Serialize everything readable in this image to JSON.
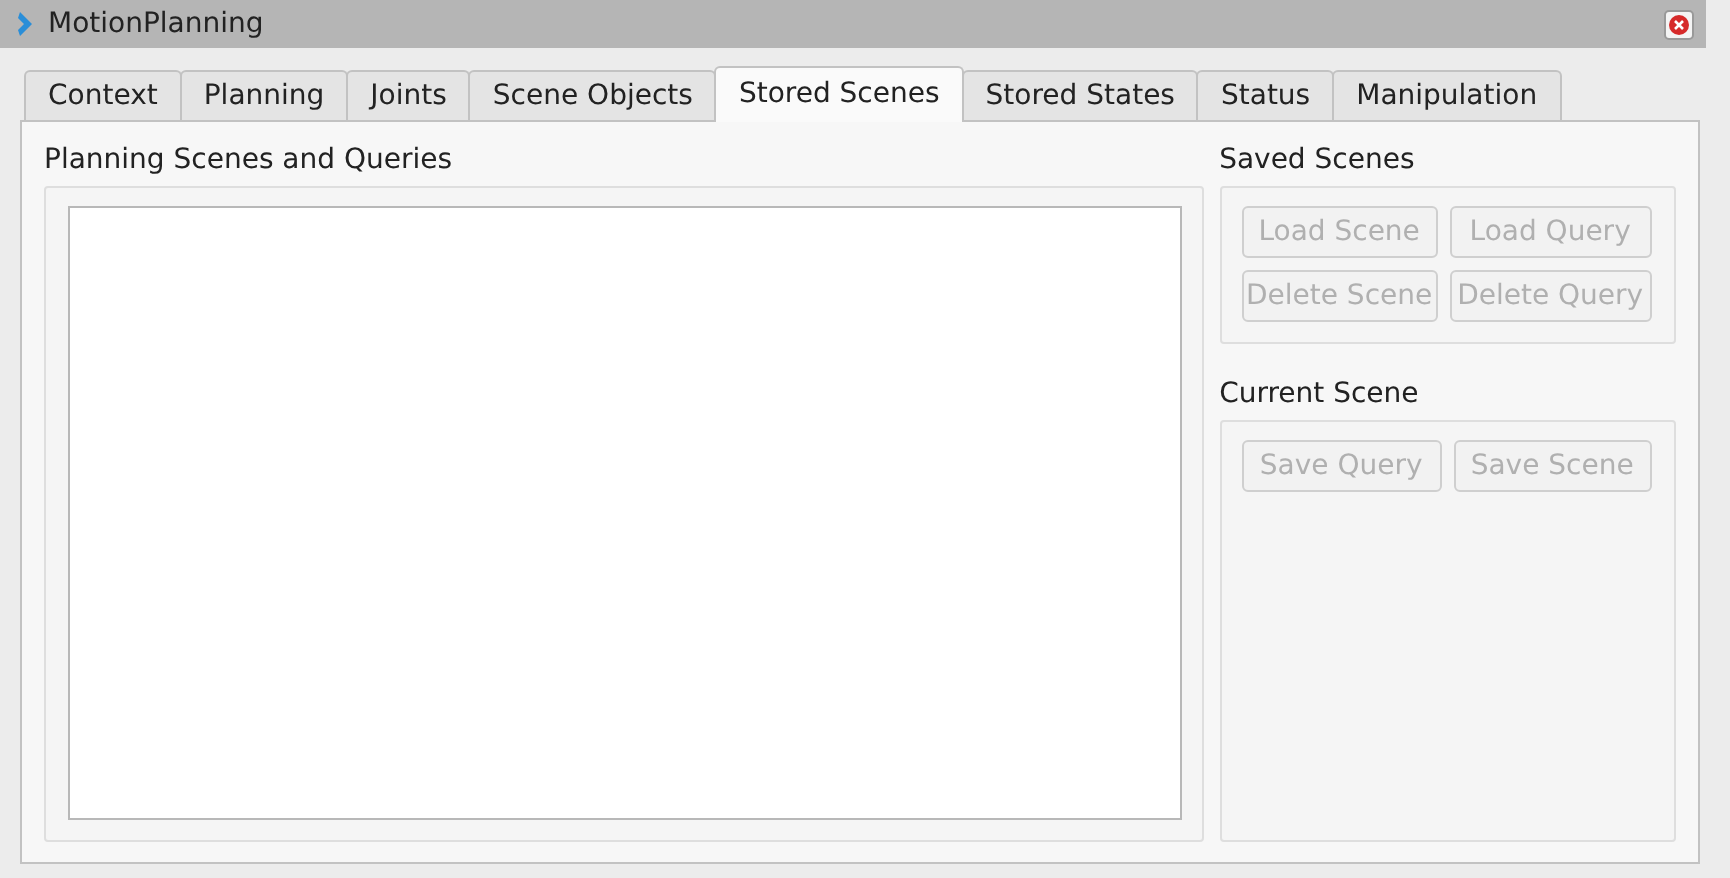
{
  "window": {
    "title": "MotionPlanning"
  },
  "tabs": [
    {
      "label": "Context",
      "selected": false
    },
    {
      "label": "Planning",
      "selected": false
    },
    {
      "label": "Joints",
      "selected": false
    },
    {
      "label": "Scene Objects",
      "selected": false
    },
    {
      "label": "Stored Scenes",
      "selected": true
    },
    {
      "label": "Stored States",
      "selected": false
    },
    {
      "label": "Status",
      "selected": false
    },
    {
      "label": "Manipulation",
      "selected": false
    }
  ],
  "scenes_list": {
    "title": "Planning Scenes and Queries"
  },
  "saved_scenes": {
    "title": "Saved Scenes",
    "buttons": [
      {
        "label": "Load Scene",
        "disabled": true
      },
      {
        "label": "Load Query",
        "disabled": true
      },
      {
        "label": "Delete Scene",
        "disabled": true
      },
      {
        "label": "Delete Query",
        "disabled": true
      }
    ]
  },
  "current_scene": {
    "title": "Current Scene",
    "buttons": [
      {
        "label": "Save Query",
        "disabled": true
      },
      {
        "label": "Save Scene",
        "disabled": true
      }
    ]
  }
}
